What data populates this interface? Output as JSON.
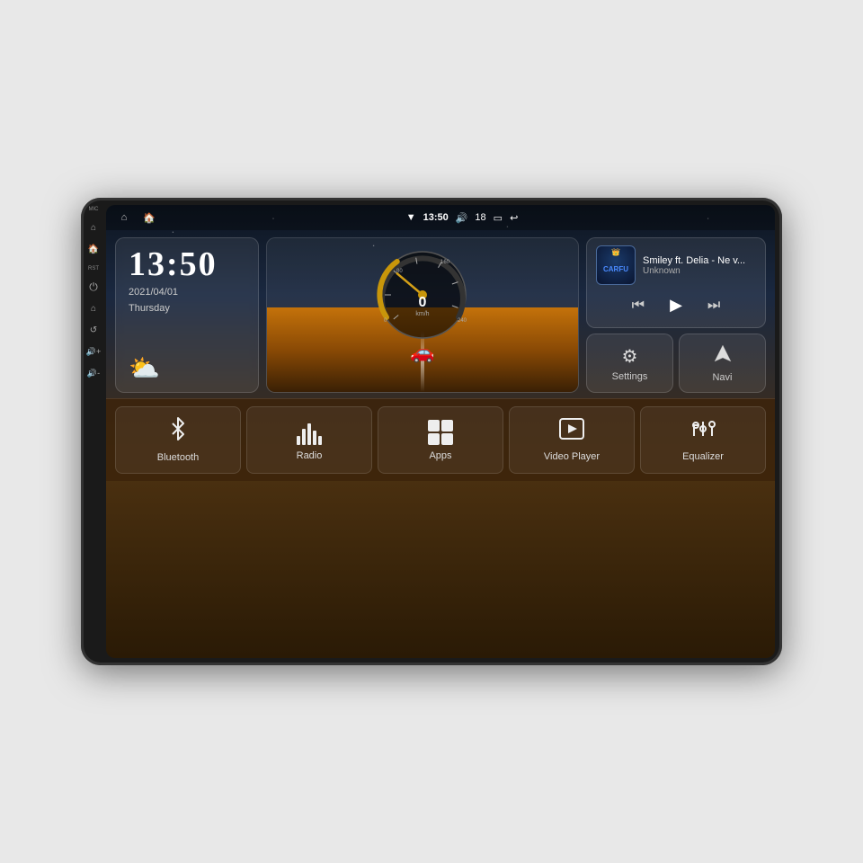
{
  "device": {
    "outer_bg": "#1a1a1a"
  },
  "status_bar": {
    "home_icon": "⌂",
    "android_icon": "🏠",
    "wifi_icon": "▼",
    "time": "13:50",
    "volume_icon": "🔊",
    "volume_level": "18",
    "window_icon": "▭",
    "back_icon": "↩"
  },
  "side_buttons": {
    "mic_label": "MIC",
    "rst_label": "RST",
    "power_icon": "⏻",
    "home_icon": "⌂",
    "back_icon": "↺",
    "vol_up_icon": "🔊+",
    "vol_down_icon": "🔊-"
  },
  "clock_widget": {
    "time": "13:50",
    "date": "2021/04/01",
    "day": "Thursday",
    "weather": "⛅"
  },
  "speedometer": {
    "speed": "0",
    "unit": "km/h",
    "max": "240"
  },
  "music_widget": {
    "title": "Smiley ft. Delia - Ne v...",
    "artist": "Unknown",
    "prev_icon": "⏮",
    "play_icon": "▶",
    "next_icon": "⏭",
    "logo": "CARFU"
  },
  "settings_widget": {
    "icon": "⚙",
    "label": "Settings"
  },
  "navi_widget": {
    "label": "Navi"
  },
  "bottom_bar": {
    "bluetooth": {
      "label": "Bluetooth"
    },
    "radio": {
      "label": "Radio"
    },
    "apps": {
      "label": "Apps"
    },
    "video_player": {
      "label": "Video Player"
    },
    "equalizer": {
      "label": "Equalizer"
    }
  }
}
